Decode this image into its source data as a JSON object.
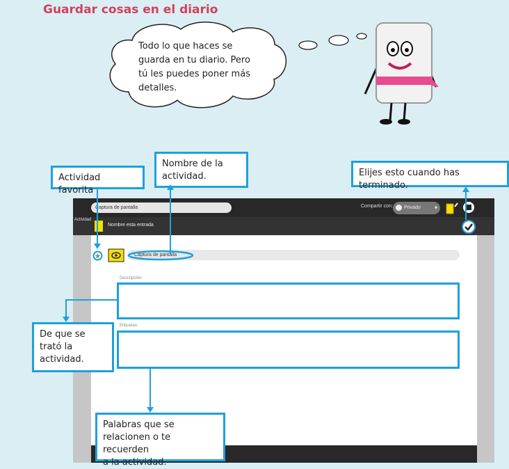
{
  "page_title": "Guardar cosas en el diario",
  "thought_bubble": {
    "lines": [
      "Todo lo que haces se",
      "guarda en tu diario. Pero",
      "tú les puedes poner más",
      "detalles."
    ]
  },
  "callouts": {
    "favorite": "Actividad favorita",
    "name_line1": "Nombre de la",
    "name_line2": "actividad.",
    "done": "Elijes esto cuando has terminado.",
    "desc_line1": "De que se",
    "desc_line2": "trató la",
    "desc_line3": "actividad.",
    "tags_line1": "Palabras  que se",
    "tags_line2": "relacionen o te recuerden",
    "tags_line3": "a la actividad."
  },
  "toolbar": {
    "title_value": "Captura de pantalla",
    "share_label": "Compartir con:",
    "share_value": "Privado"
  },
  "secondbar": {
    "activity_tab": "Actividad",
    "entry_name": "Nombre esta entrada"
  },
  "entry": {
    "name_value": "Captura de pantalla",
    "description_label": "Descripción:",
    "tags_label": "Etiquetas:"
  },
  "colors": {
    "background": "#dbeef3",
    "title": "#d0425e",
    "callout_border": "#1ea0dc",
    "toolbar": "#282828",
    "journal_icon": "#f5e000"
  },
  "icons": [
    "star-icon",
    "journal-icon",
    "checkmark-icon",
    "stop-icon",
    "share-icon",
    "chevron-down-icon"
  ]
}
